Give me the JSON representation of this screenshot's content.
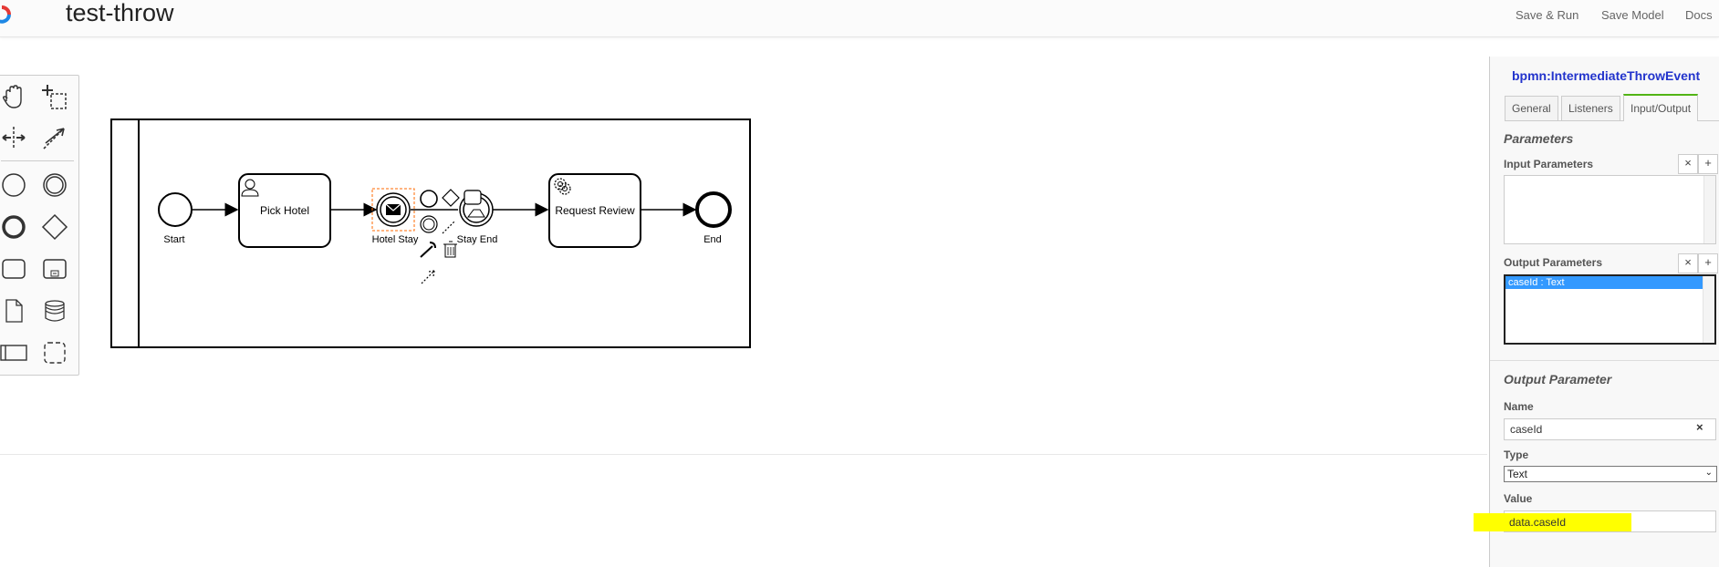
{
  "app": {
    "title": "test-throw",
    "buttons": {
      "save_run": "Save & Run",
      "save_model": "Save Model",
      "docs": "Docs"
    }
  },
  "palette": {
    "tools": [
      "hand-tool",
      "lasso-tool",
      "space-tool",
      "global-connect-tool",
      "start-event",
      "intermediate-event",
      "end-event",
      "gateway",
      "task",
      "subprocess",
      "data-object",
      "data-store",
      "participant",
      "group"
    ]
  },
  "diagram": {
    "nodes": {
      "start": "Start",
      "pick_hotel": "Pick Hotel",
      "hotel_stay": "Hotel Stay",
      "stay_end": "Stay End",
      "request_review": "Request Review",
      "end": "End"
    }
  },
  "properties": {
    "element_type": "bpmn:IntermediateThrowEvent",
    "tabs": [
      "General",
      "Listeners",
      "Input/Output"
    ],
    "active_tab": "Input/Output",
    "parameters_title": "Parameters",
    "input_parameters_label": "Input Parameters",
    "output_parameters_label": "Output Parameters",
    "output_parameters": [
      "caseId : Text"
    ],
    "output_parameter_title": "Output Parameter",
    "name_label": "Name",
    "name_value": "caseId",
    "type_label": "Type",
    "type_value": "Text",
    "value_label": "Value",
    "value_value": "data.caseId",
    "remove_symbol": "×",
    "add_symbol": "+"
  },
  "colors": {
    "accent_tab": "#52b415",
    "title_blue": "#2233cc",
    "selection": "#3399ff",
    "highlight": "#ffff00"
  }
}
